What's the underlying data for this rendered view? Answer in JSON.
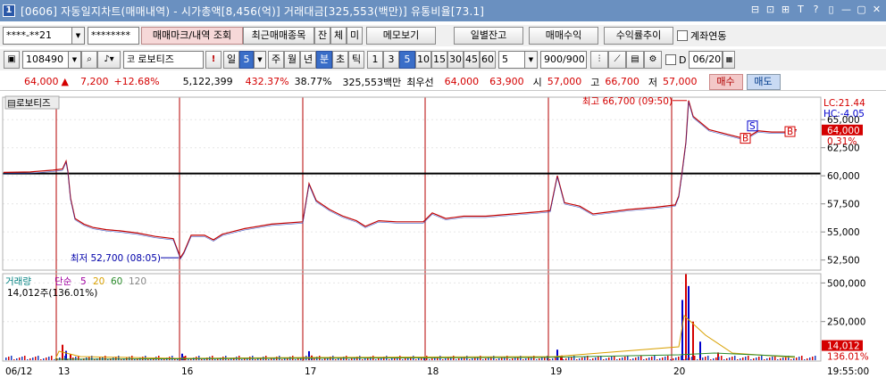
{
  "window": {
    "number": "1",
    "title": "[0606] 자동일지차트(매매내역) - 시가총액[8,456(억)] 거래대금[325,553(백만)] 유통비율[73.1]",
    "controls": [
      "⊟",
      "⊡",
      "⊞",
      "T",
      "?",
      "▯",
      "—",
      "▢",
      "✕"
    ]
  },
  "toolbar1": {
    "account": "****-**21",
    "password": "********",
    "mark_btn": "매매마크/내역 조회",
    "recent_btn": "최근매매종목",
    "jan": "잔",
    "che": "체",
    "mi": "미",
    "memo": "메모보기",
    "daily": "일별잔고",
    "profit": "매매수익",
    "rate": "수익률추이",
    "link": "계좌연동"
  },
  "toolbar2": {
    "code": "108490",
    "name": "로보티즈",
    "il": "일",
    "il_num": "5",
    "ju": "주",
    "wol": "월",
    "nyeon": "년",
    "bun": "분",
    "cho": "초",
    "tik": "틱",
    "intervals": [
      "1",
      "3",
      "5",
      "10",
      "15",
      "30",
      "45",
      "60"
    ],
    "selected_interval": "5",
    "count_val": "5",
    "range": "900/900",
    "date_chk_label": "D",
    "date": "06/20"
  },
  "quote": {
    "price": "64,000",
    "arrow": "▲",
    "change": "7,200",
    "pct": "+12.68%",
    "volume": "5,122,399",
    "vol_pct": "432.37%",
    "turnover": "38.77%",
    "amount": "325,553백만",
    "best_label": "최우선",
    "ask": "64,000",
    "bid": "63,900",
    "open_label": "시",
    "open": "57,000",
    "high_label": "고",
    "high": "66,700",
    "low_label": "저",
    "low": "57,000",
    "buy": "매수",
    "sell": "매도"
  },
  "chart_data": {
    "type": "line",
    "title": "로보티즈",
    "x_ticks": [
      "06/12",
      "13",
      "16",
      "17",
      "18",
      "19",
      "20"
    ],
    "price_axis": {
      "ticks": [
        "65,000",
        "62,500",
        "60,000",
        "57,500",
        "55,000",
        "52,500"
      ],
      "range": [
        51600,
        67000
      ],
      "current": "64,000",
      "current_pct": "0.31%",
      "lc": "LC:21.44",
      "hc": "HC:-4.05"
    },
    "reference_line": 60200,
    "high_annotation": "최고 66,700 (09:50)",
    "low_annotation": "최저 52,700 (08:05)",
    "markers": [
      {
        "label": "S",
        "x": 842,
        "y": 64400
      },
      {
        "label": "B",
        "x": 834,
        "y": 63300
      },
      {
        "label": "B",
        "x": 884,
        "y": 63900
      }
    ],
    "price_series": [
      [
        0,
        60300
      ],
      [
        30,
        60350
      ],
      [
        55,
        60500
      ],
      [
        66,
        60600
      ],
      [
        70,
        61300
      ],
      [
        72,
        60400
      ],
      [
        75,
        58000
      ],
      [
        80,
        56200
      ],
      [
        90,
        55700
      ],
      [
        100,
        55400
      ],
      [
        115,
        55200
      ],
      [
        130,
        55100
      ],
      [
        150,
        54900
      ],
      [
        170,
        54600
      ],
      [
        190,
        54400
      ],
      [
        198,
        52700
      ],
      [
        202,
        53200
      ],
      [
        210,
        54700
      ],
      [
        225,
        54700
      ],
      [
        235,
        54300
      ],
      [
        245,
        54800
      ],
      [
        270,
        55300
      ],
      [
        300,
        55700
      ],
      [
        335,
        55900
      ],
      [
        342,
        59300
      ],
      [
        350,
        57800
      ],
      [
        365,
        57000
      ],
      [
        380,
        56400
      ],
      [
        395,
        56000
      ],
      [
        405,
        55500
      ],
      [
        420,
        56000
      ],
      [
        440,
        55900
      ],
      [
        470,
        55900
      ],
      [
        480,
        56700
      ],
      [
        495,
        56200
      ],
      [
        515,
        56400
      ],
      [
        540,
        56400
      ],
      [
        570,
        56600
      ],
      [
        600,
        56800
      ],
      [
        612,
        56900
      ],
      [
        620,
        60000
      ],
      [
        628,
        57600
      ],
      [
        645,
        57300
      ],
      [
        660,
        56600
      ],
      [
        680,
        56800
      ],
      [
        700,
        57000
      ],
      [
        730,
        57200
      ],
      [
        752,
        57400
      ],
      [
        756,
        58200
      ],
      [
        760,
        60500
      ],
      [
        764,
        63000
      ],
      [
        767,
        66700
      ],
      [
        772,
        65300
      ],
      [
        790,
        64100
      ],
      [
        810,
        63700
      ],
      [
        830,
        63300
      ],
      [
        845,
        64000
      ],
      [
        860,
        63900
      ],
      [
        875,
        63900
      ],
      [
        888,
        64100
      ]
    ],
    "volume_panel": {
      "legend": [
        "거래량",
        "단순",
        "5",
        "20",
        "60",
        "120"
      ],
      "value": "14,012주(136.01%)",
      "ticks": [
        "500,000",
        "250,000"
      ],
      "range": [
        0,
        560000
      ],
      "current": "14,012",
      "current_pct": "136.01%"
    },
    "volume_series": [
      [
        66,
        100000
      ],
      [
        70,
        60000
      ],
      [
        75,
        40000
      ],
      [
        200,
        42000
      ],
      [
        202,
        24000
      ],
      [
        342,
        58000
      ],
      [
        345,
        30000
      ],
      [
        620,
        68000
      ],
      [
        625,
        30000
      ],
      [
        760,
        390000
      ],
      [
        764,
        560000
      ],
      [
        767,
        480000
      ],
      [
        772,
        250000
      ],
      [
        780,
        120000
      ],
      [
        800,
        50000
      ]
    ],
    "time_label": "19:55:00"
  },
  "colors": {
    "up": "#d40000",
    "down": "#0000cc",
    "title_bar": "#6a90c0",
    "day_separator": "#b40000",
    "reference_line": "#000000"
  }
}
